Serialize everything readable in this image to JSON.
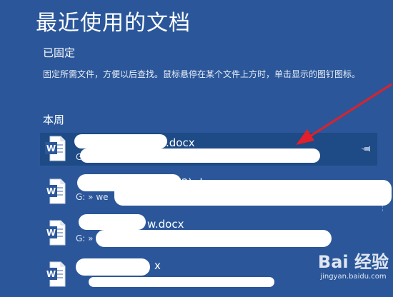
{
  "header": {
    "title": "最近使用的文档"
  },
  "pinned": {
    "heading": "已固定",
    "description": "固定所需文件，方便以后查找。鼠标悬停在某个文件上方时，单击显示的图钉图标。"
  },
  "this_week": {
    "heading": "本周",
    "files": [
      {
        "name": ".docx",
        "path": "G:"
      },
      {
        "name": "(2).docx",
        "path": "G: » we"
      },
      {
        "name": "w.docx",
        "path": "G: »"
      },
      {
        "name": "x",
        "path": ""
      }
    ]
  },
  "watermark": {
    "main": "Bai 经验",
    "sub": "jingyan.baidu.com"
  },
  "colors": {
    "background": "#2b579a",
    "selected_row": "#1e4a86",
    "arrow": "#e0202a",
    "word_icon": "#2b579a"
  }
}
